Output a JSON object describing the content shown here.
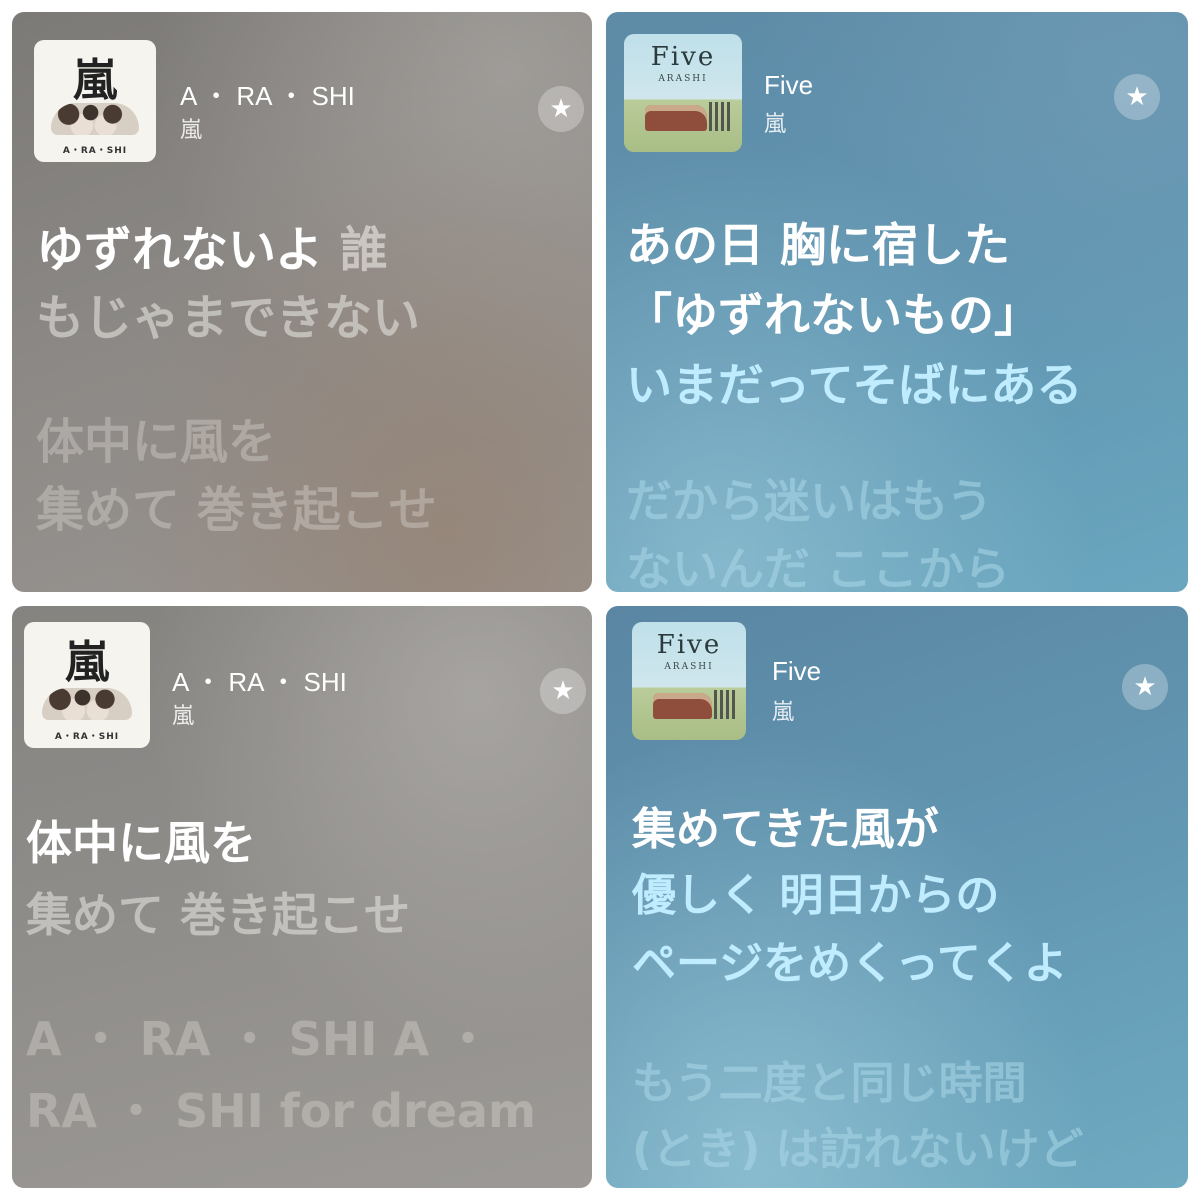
{
  "cards": {
    "tl": {
      "album_art": {
        "title": "嵐",
        "small_text": "A・RA・SHI"
      },
      "title": "A ・ RA ・ SHI",
      "artist": "嵐",
      "star": "★",
      "lyrics": {
        "l1_active": "ゆずれないよ",
        "l1_dim": "誰",
        "l2": "もじゃまできない",
        "l3": "体中に風を",
        "l4": "集めて 巻き起こせ"
      }
    },
    "tr": {
      "album_art": {
        "title": "Five",
        "subtitle": "ARASHI"
      },
      "title": "Five",
      "artist": "嵐",
      "star": "★",
      "lyrics": {
        "l1": "あの日 胸に宿した",
        "l2": "「ゆずれないもの」",
        "l3": "いまだってそばにある",
        "l4": "だから迷いはもう",
        "l5": "ないんだ ここから"
      }
    },
    "bl": {
      "album_art": {
        "title": "嵐",
        "small_text": "A・RA・SHI"
      },
      "title": "A ・ RA ・ SHI",
      "artist": "嵐",
      "star": "★",
      "lyrics": {
        "l1": "体中に風を",
        "l2": "集めて 巻き起こせ",
        "l3": "A ・ RA ・ SHI A ・",
        "l4": "RA ・ SHI for dream"
      }
    },
    "br": {
      "album_art": {
        "title": "Five",
        "subtitle": "ARASHI"
      },
      "title": "Five",
      "artist": "嵐",
      "star": "★",
      "lyrics": {
        "l1": "集めてきた風が",
        "l2": "優しく 明日からの",
        "l3": "ページをめくってくよ",
        "l4": "もう二度と同じ時間",
        "l5": "(とき) は訪れないけど"
      }
    }
  }
}
